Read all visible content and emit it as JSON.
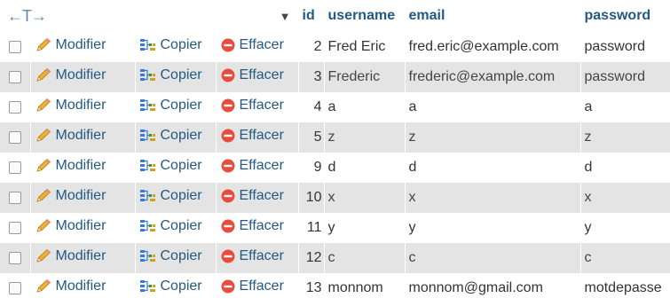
{
  "header": {
    "tools_arrows": "←T→",
    "columns": [
      {
        "key": "id",
        "label": "id"
      },
      {
        "key": "username",
        "label": "username"
      },
      {
        "key": "email",
        "label": "email"
      },
      {
        "key": "password",
        "label": "password"
      }
    ]
  },
  "actions": {
    "edit_label": "Modifier",
    "copy_label": "Copier",
    "delete_label": "Effacer"
  },
  "icons": {
    "edit": "pencil-icon",
    "copy": "copy-icon",
    "delete": "delete-icon",
    "sort": "caret-down-icon"
  },
  "colors": {
    "link": "#235a81",
    "row_alt": "#e4e4e4",
    "delete_icon": "#e74c3c",
    "pencil_icon": "#f0b030"
  },
  "rows": [
    {
      "id": "2",
      "username": "Fred Eric",
      "email": "fred.eric@example.com",
      "password": "password"
    },
    {
      "id": "3",
      "username": "Frederic",
      "email": "frederic@example.com",
      "password": "password"
    },
    {
      "id": "4",
      "username": "a",
      "email": "a",
      "password": "a"
    },
    {
      "id": "5",
      "username": "z",
      "email": "z",
      "password": "z"
    },
    {
      "id": "9",
      "username": "d",
      "email": "d",
      "password": "d"
    },
    {
      "id": "10",
      "username": "x",
      "email": "x",
      "password": "x"
    },
    {
      "id": "11",
      "username": "y",
      "email": "y",
      "password": "y"
    },
    {
      "id": "12",
      "username": "c",
      "email": "c",
      "password": "c"
    },
    {
      "id": "13",
      "username": "monnom",
      "email": "monnom@gmail.com",
      "password": "motdepasse"
    }
  ]
}
